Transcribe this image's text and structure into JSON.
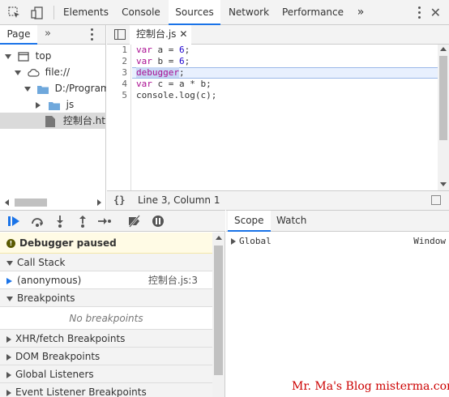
{
  "devtools": {
    "tabs": [
      "Elements",
      "Console",
      "Sources",
      "Network",
      "Performance"
    ],
    "active_tab": "Sources",
    "more_tabs": "»"
  },
  "navigator": {
    "tab": "Page",
    "more": "»",
    "tree": [
      {
        "label": "top",
        "icon": "frame-icon"
      },
      {
        "label": "file://",
        "icon": "cloud-icon"
      },
      {
        "label": "D:/Program%",
        "icon": "folder-icon"
      },
      {
        "label": "js",
        "icon": "folder-icon"
      },
      {
        "label": "控制台.htm",
        "icon": "file-icon"
      }
    ]
  },
  "editor": {
    "file_tab": "控制台.js",
    "lines": [
      "1",
      "2",
      "3",
      "4",
      "5"
    ],
    "code": {
      "l1_kw": "var",
      "l1_rest": " a = ",
      "l1_num": "6",
      "l1_end": ";",
      "l2_kw": "var",
      "l2_rest": " b = ",
      "l2_num": "6",
      "l2_end": ";",
      "l3_word": "debugger",
      "l3_end": ";",
      "l4_kw": "var",
      "l4_rest": " c = a * b;",
      "l5": "console.log(c);"
    },
    "current_line": 3,
    "status_braces": "{}",
    "cursor_position": "Line 3, Column 1"
  },
  "debugger": {
    "paused_text": "Debugger paused",
    "call_stack": "Call Stack",
    "frame_name": "(anonymous)",
    "frame_location": "控制台.js:3",
    "breakpoints": "Breakpoints",
    "no_breakpoints": "No breakpoints",
    "xhr": "XHR/fetch Breakpoints",
    "dom": "DOM Breakpoints",
    "global": "Global Listeners",
    "event": "Event Listener Breakpoints"
  },
  "scope": {
    "tabs": [
      "Scope",
      "Watch"
    ],
    "entry_name": "Global",
    "entry_value": "Window"
  },
  "watermark": "Mr. Ma's Blog  misterma.com",
  "colors": {
    "accent": "#1a73e8",
    "paused_bg": "#fffbe5",
    "keyword": "#aa0d91",
    "number": "#1c00cf"
  }
}
